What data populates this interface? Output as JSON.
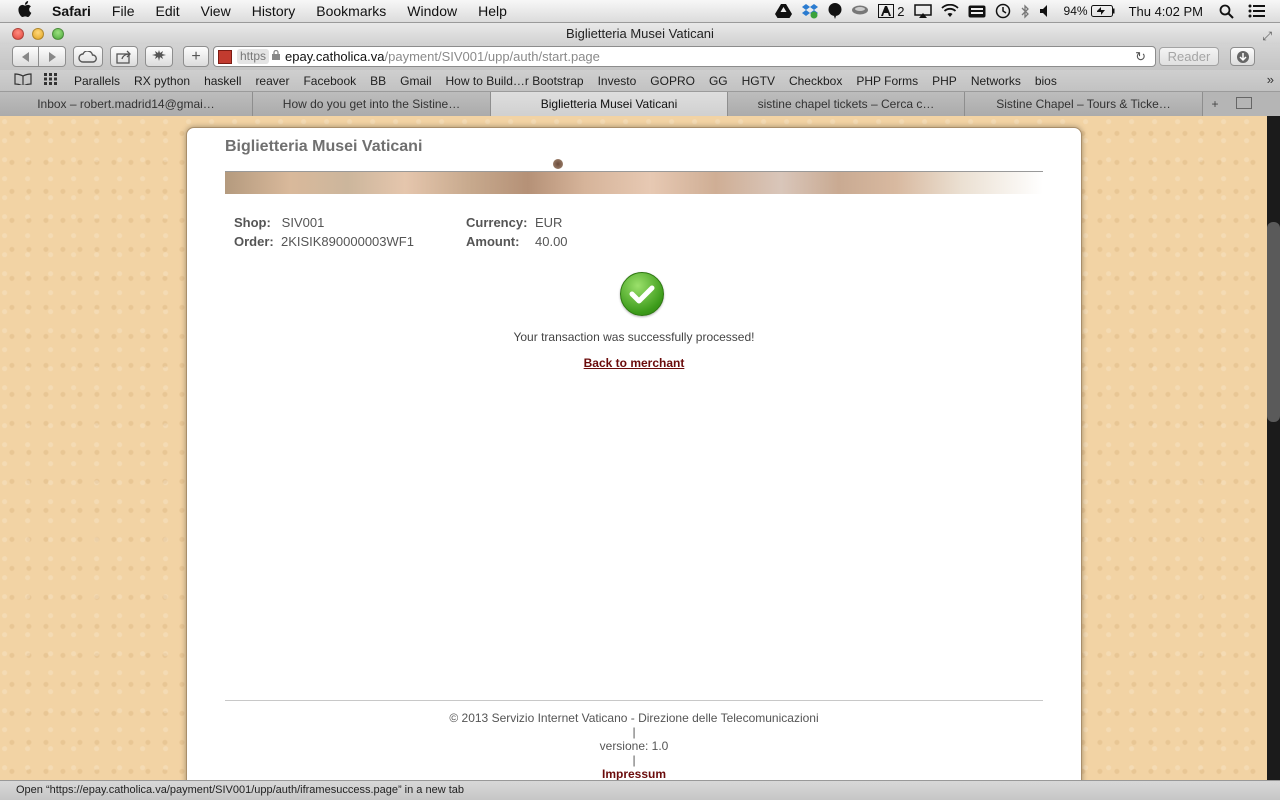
{
  "menubar": {
    "app": "Safari",
    "items": [
      "File",
      "Edit",
      "View",
      "History",
      "Bookmarks",
      "Window",
      "Help"
    ],
    "status": {
      "adobe_count": "2",
      "battery": "94%",
      "clock": "Thu 4:02 PM"
    }
  },
  "window": {
    "title": "Biglietteria Musei Vaticani"
  },
  "toolbar": {
    "url_scheme": "https",
    "url_host": "epay.catholica.va",
    "url_path": "/payment/SIV001/upp/auth/start.page",
    "reader_label": "Reader"
  },
  "bookmarks": [
    "Parallels",
    "RX python",
    "haskell",
    "reaver",
    "Facebook",
    "BB",
    "Gmail",
    "How to Build…r Bootstrap",
    "Investo",
    "GOPRO",
    "GG",
    "HGTV",
    "Checkbox",
    "PHP Forms",
    "PHP",
    "Networks",
    "bios"
  ],
  "tabs": [
    {
      "label": "Inbox – robert.madrid14@gmai…",
      "active": false
    },
    {
      "label": "How do you get into the Sistine…",
      "active": false
    },
    {
      "label": "Biglietteria Musei Vaticani",
      "active": true
    },
    {
      "label": "sistine chapel tickets – Cerca c…",
      "active": false
    },
    {
      "label": "Sistine Chapel – Tours & Ticke…",
      "active": false
    }
  ],
  "page": {
    "title": "Biglietteria Musei Vaticani",
    "shop_label": "Shop:",
    "shop_value": "SIV001",
    "order_label": "Order:",
    "order_value": "2KISIK890000003WF1",
    "currency_label": "Currency:",
    "currency_value": "EUR",
    "amount_label": "Amount:",
    "amount_value": "40.00",
    "success_message": "Your transaction was successfully processed!",
    "back_link": "Back to merchant",
    "footer_copyright": "© 2013 Servizio Internet Vaticano - Direzione delle Telecomunicazioni",
    "footer_sep": "|",
    "footer_version": "versione: 1.0",
    "footer_impressum": "Impressum"
  },
  "statusbar": {
    "text": "Open “https://epay.catholica.va/payment/SIV001/upp/auth/iframesuccess.page” in a new tab"
  },
  "colors": {
    "link": "#6b0b0b",
    "success_green": "#3c9b1a",
    "page_background": "#f2d3a4"
  }
}
